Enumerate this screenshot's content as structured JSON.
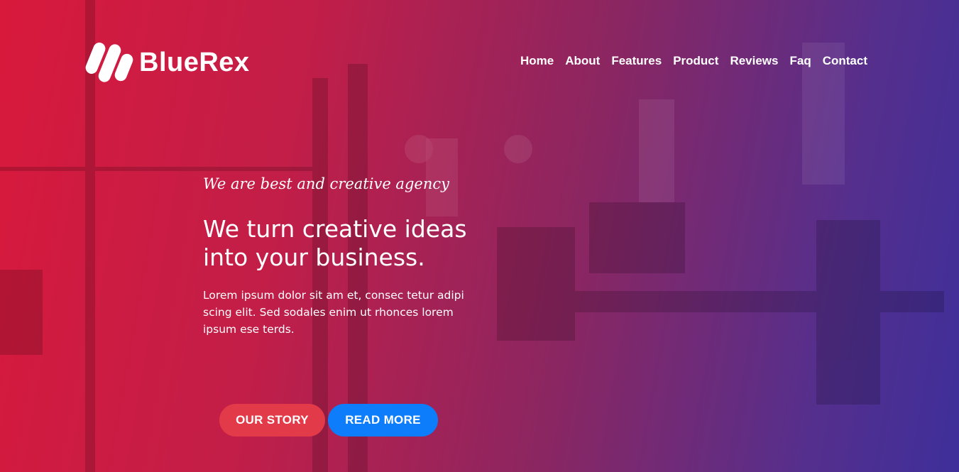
{
  "brand": {
    "name": "BlueRex"
  },
  "nav": {
    "items": [
      {
        "label": "Home"
      },
      {
        "label": "About"
      },
      {
        "label": "Features"
      },
      {
        "label": "Product"
      },
      {
        "label": "Reviews"
      },
      {
        "label": "Faq"
      },
      {
        "label": "Contact"
      }
    ]
  },
  "hero": {
    "tagline": "We are best and creative agency",
    "headline": "We turn creative ideas into your business.",
    "body": "Lorem ipsum dolor sit am et, consec tetur adipi scing elit. Sed sodales enim ut rhonces lorem ipsum ese terds.",
    "buttons": {
      "story_label": "OUR STORY",
      "more_label": "READ MORE"
    }
  },
  "colors": {
    "gradient_start": "#d8193c",
    "gradient_end": "#3e2f9a",
    "story_button": "#e23a48",
    "more_button": "#0d7dfb"
  }
}
